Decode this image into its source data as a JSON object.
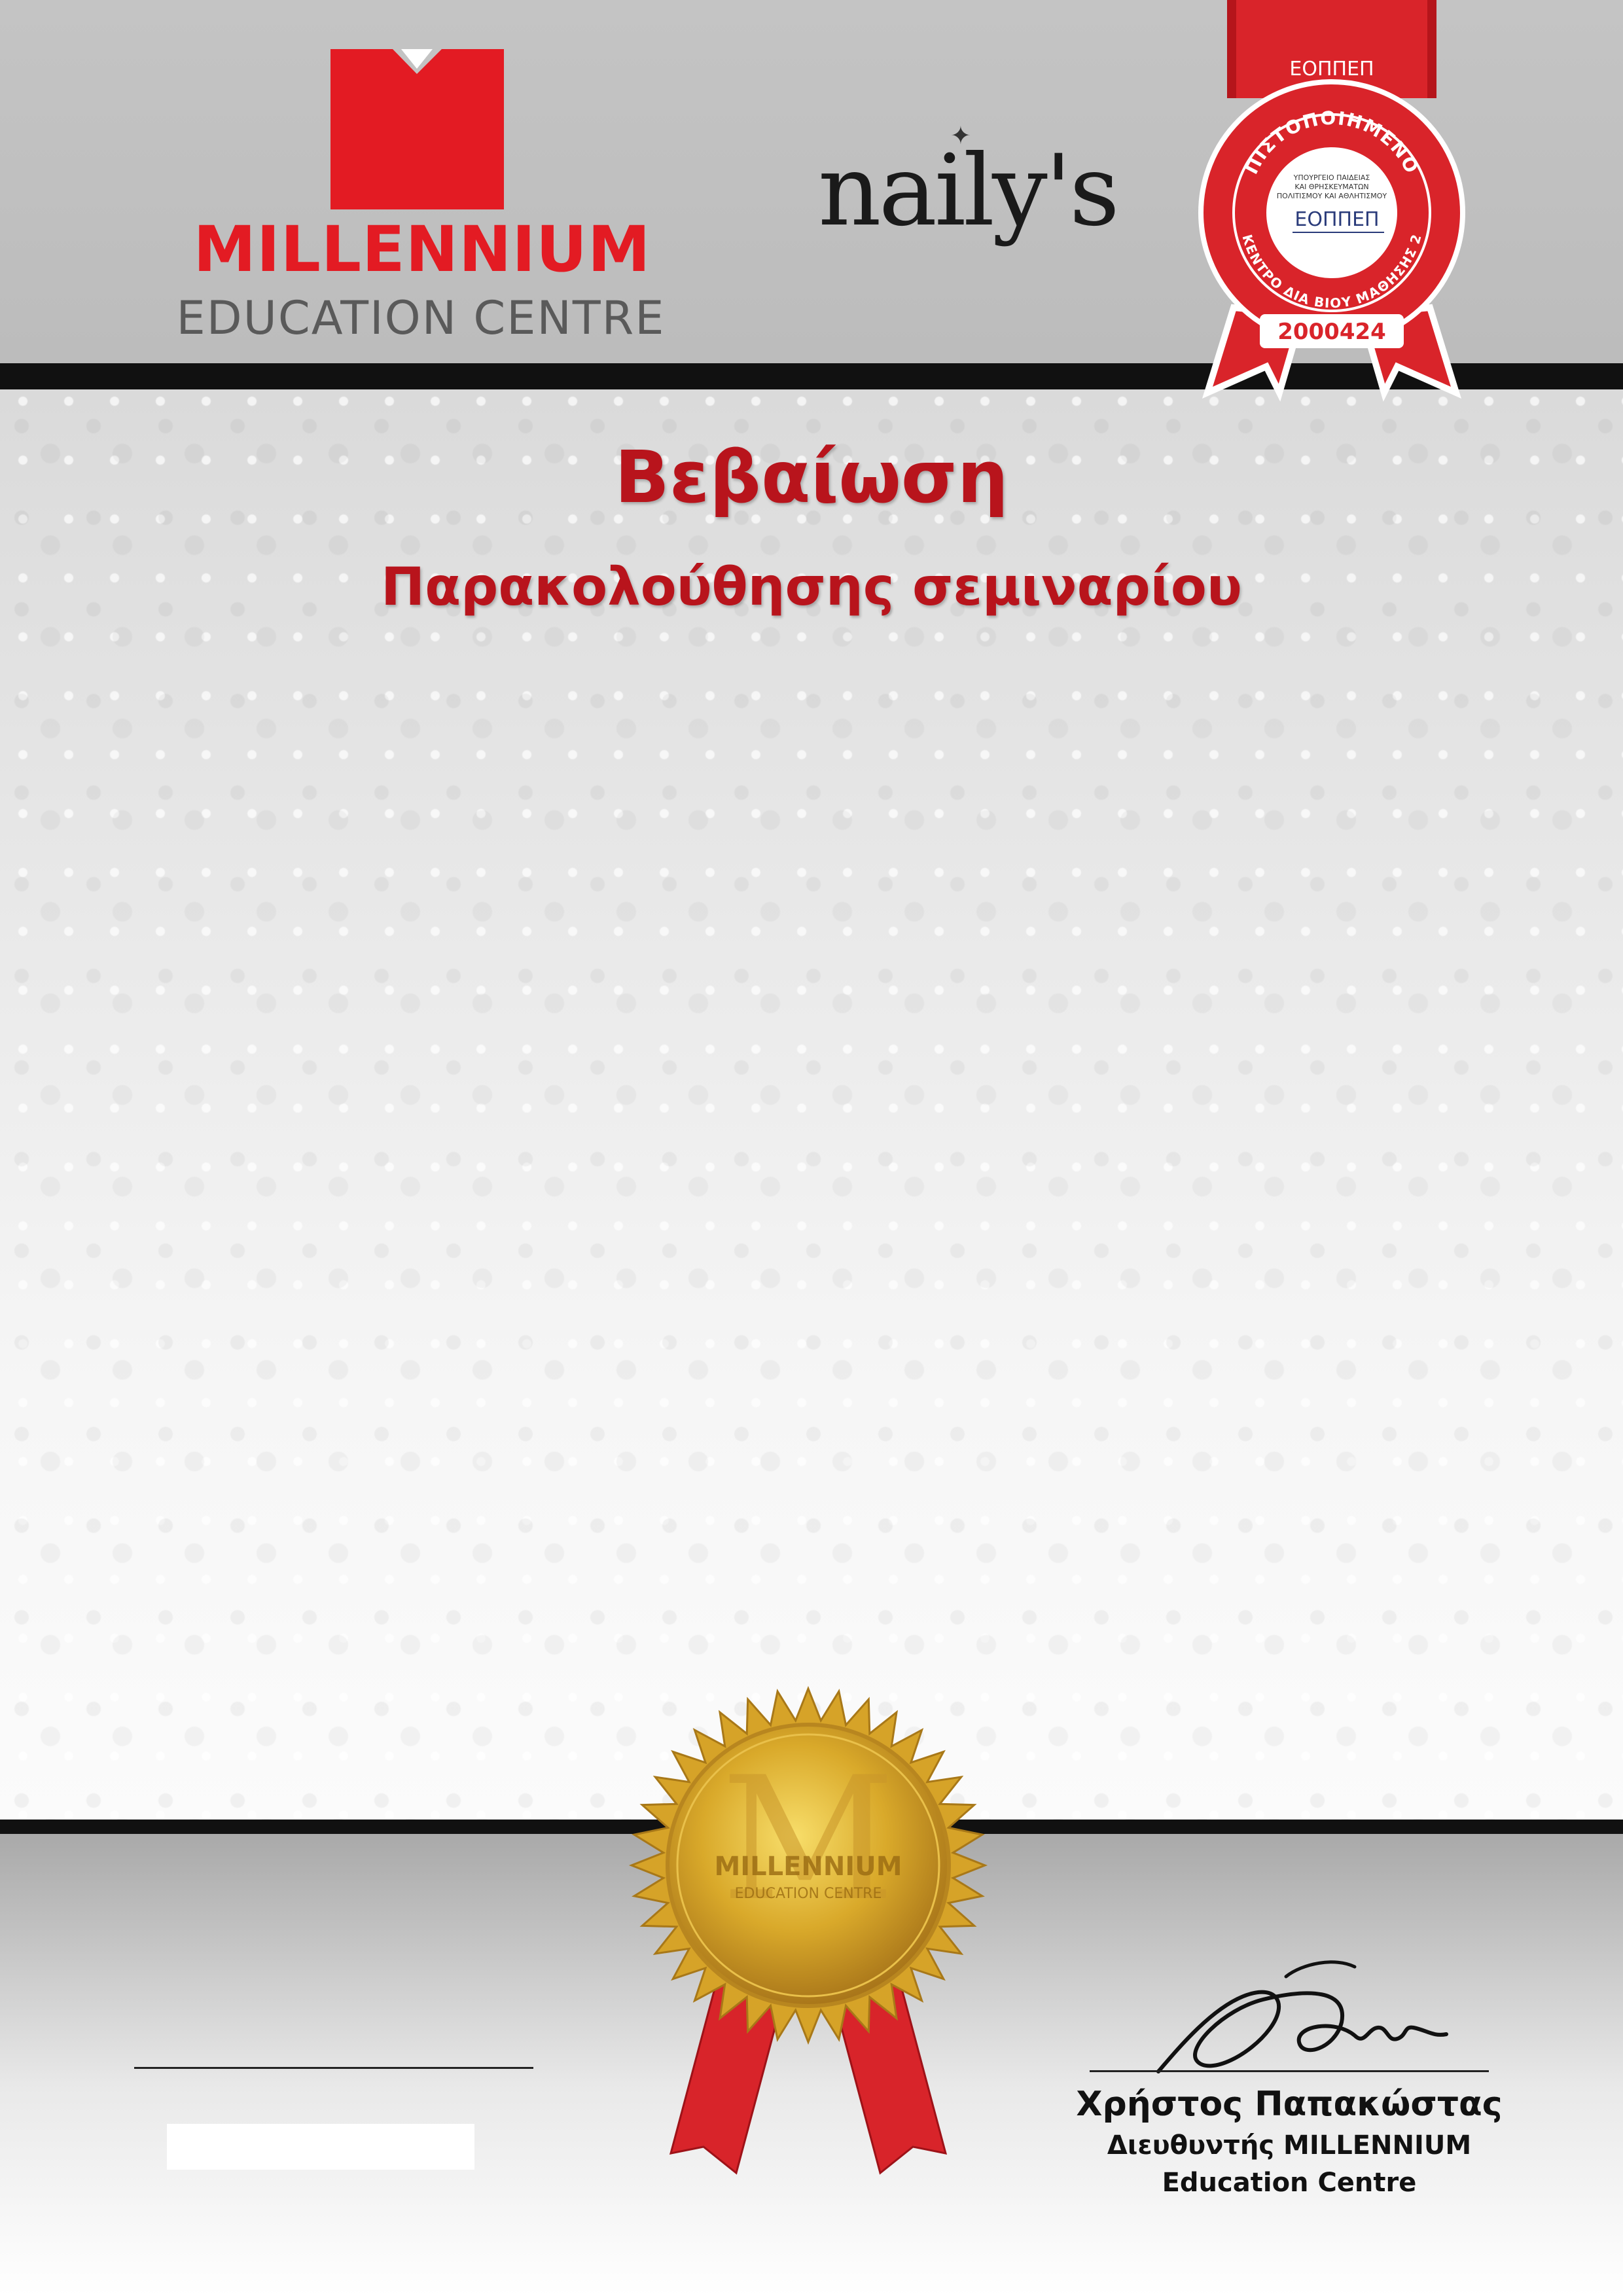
{
  "header": {
    "brand_name": "MILLENNIUM",
    "brand_subtitle": "EDUCATION CENTRE",
    "partner_name": "naily's",
    "brand_color": "#e31b23"
  },
  "badge": {
    "top_label": "ΕΟΠΠΕΠ",
    "arc_top": "ΠΙΣΤΟΠΟΙΗΜΕΝΟ",
    "ministry_line1": "ΥΠΟΥΡΓΕΙΟ ΠΑΙΔΕΙΑΣ",
    "ministry_line2": "ΚΑΙ ΘΡΗΣΚΕΥΜΑΤΩΝ",
    "ministry_line3": "ΠΟΛΙΤΙΣΜΟΥ ΚΑΙ ΑΘΛΗΤΙΣΜΟΥ",
    "logo_text": "ΕΟΠΠΕΠ",
    "arc_bottom": "ΚΕΝΤΡΟ ΔΙΑ ΒΙΟΥ ΜΑΘΗΣΗΣ 2",
    "code": "2000424"
  },
  "document": {
    "title": "Βεβαίωση",
    "subtitle": "Παρακολούθησης σεμιναρίου"
  },
  "seal": {
    "line1": "MILLENNIUM",
    "line2": "EDUCATION CENTRE"
  },
  "signatory": {
    "name": "Χρήστος Παπακώστας",
    "role": "Διευθυντής MILLENNIUM",
    "org": "Education Centre"
  }
}
